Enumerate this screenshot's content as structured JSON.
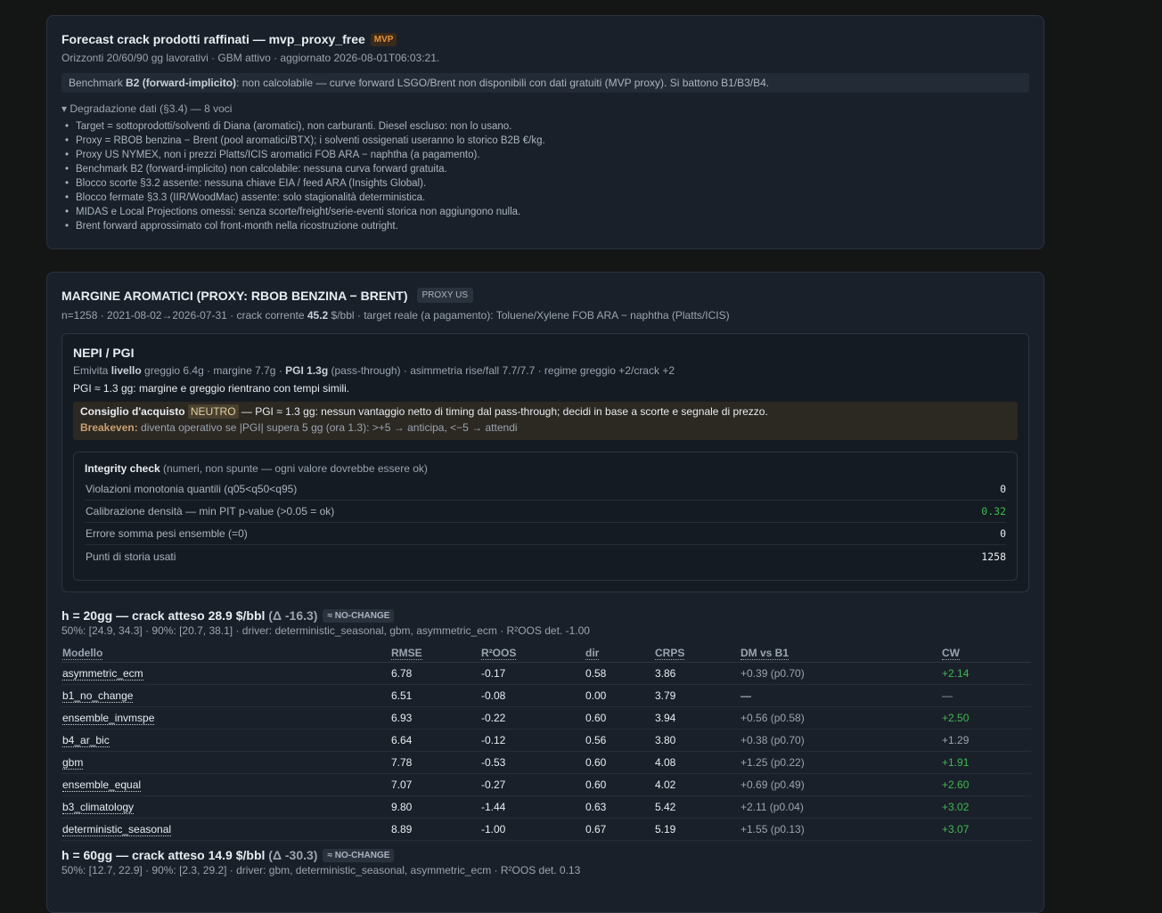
{
  "header": {
    "title": "Forecast crack prodotti raffinati — mvp_proxy_free",
    "badge": "MVP",
    "subtitle": "Orizzonti 20/60/90 gg lavorativi · GBM attivo · aggiornato 2026-08-01T06:03:21.",
    "note_prefix": "Benchmark ",
    "note_bold": "B2 (forward-implicito)",
    "note_rest": ": non calcolabile — curve forward LSGO/Brent non disponibili con dati gratuiti (MVP proxy). Si battono B1/B3/B4.",
    "degradation_summary": "▾ Degradazione dati (§3.4) — 8 voci",
    "degradation_items": [
      "Target = sottoprodotti/solventi di Diana (aromatici), non carburanti. Diesel escluso: non lo usano.",
      "Proxy = RBOB benzina − Brent (pool aromatici/BTX); i solventi ossigenati useranno lo storico B2B €/kg.",
      "Proxy US NYMEX, non i prezzi Platts/ICIS aromatici FOB ARA − naphtha (a pagamento).",
      "Benchmark B2 (forward-implicito) non calcolabile: nessuna curva forward gratuita.",
      "Blocco scorte §3.2 assente: nessuna chiave EIA / feed ARA (Insights Global).",
      "Blocco fermate §3.3 (IIR/WoodMac) assente: solo stagionalità deterministica.",
      "MIDAS e Local Projections omessi: senza scorte/freight/serie-eventi storica non aggiungono nulla.",
      "Brent forward approssimato col front-month nella ricostruzione outright."
    ]
  },
  "section": {
    "title": "MARGINE AROMATICI (PROXY: RBOB BENZINA − BRENT)",
    "badge": "PROXY US",
    "sub_pre": "n=1258 · 2021-08-02→2026-07-31 · crack corrente ",
    "sub_bold": "45.2",
    "sub_post": " $/bbl · target reale (a pagamento): Toluene/Xylene FOB ARA − naphtha (Platts/ICIS)",
    "nepi": {
      "title": "NEPI / PGI",
      "sub_a": "Emivita ",
      "sub_b": "livello",
      "sub_c": " greggio 6.4g · margine 7.7g · ",
      "sub_d": "PGI 1.3g",
      "sub_e": " (pass-through) · asimmetria rise/fall 7.7/7.7 · regime greggio +2/crack +2",
      "text": "PGI ≈ 1.3 gg: margine e greggio rientrano con tempi simili.",
      "advice_label": "Consiglio d'acquisto",
      "advice_badge": "NEUTRO",
      "advice_text": " — PGI ≈ 1.3 gg: nessun vantaggio netto di timing dal pass-through; decidi in base a scorte e segnale di prezzo.",
      "breakeven_label": "Breakeven:",
      "breakeven_text": " diventa operativo se |PGI| supera 5 gg (ora 1.3): >+5 → anticipa, <−5 → attendi"
    },
    "integrity": {
      "title": "Integrity check",
      "subtitle": " (numeri, non spunte — ogni valore dovrebbe essere ok)",
      "rows": [
        {
          "label": "Violazioni monotonia quantili (q05<q50<q95)",
          "value": "0"
        },
        {
          "label": "Calibrazione densità — min PIT p-value (>0.05 = ok)",
          "value": "0.32"
        },
        {
          "label": "Errore somma pesi ensemble (=0)",
          "value": "0"
        },
        {
          "label": "Punti di storia usati",
          "value": "1258"
        }
      ]
    },
    "h20": {
      "head_a": "h = 20gg — crack atteso ",
      "head_b": "28.9",
      "head_c": " $/bbl ",
      "delta": "(Δ -16.3)",
      "badge": "≈ NO-CHANGE",
      "sub": "50%: [24.9, 34.3] · 90%: [20.7, 38.1] · driver: deterministic_seasonal, gbm, asymmetric_ecm · R²OOS det. -1.00",
      "columns": [
        "Modello",
        "RMSE",
        "R²OOS",
        "dir",
        "CRPS",
        "DM vs B1",
        "CW"
      ],
      "rows": [
        [
          "asymmetric_ecm",
          "6.78",
          "-0.17",
          "0.58",
          "3.86",
          "+0.39 (p0.70)",
          "+2.14"
        ],
        [
          "b1_no_change",
          "6.51",
          "-0.08",
          "0.00",
          "3.79",
          "—",
          "—"
        ],
        [
          "ensemble_invmspe",
          "6.93",
          "-0.22",
          "0.60",
          "3.94",
          "+0.56 (p0.58)",
          "+2.50"
        ],
        [
          "b4_ar_bic",
          "6.64",
          "-0.12",
          "0.56",
          "3.80",
          "+0.38 (p0.70)",
          "+1.29"
        ],
        [
          "gbm",
          "7.78",
          "-0.53",
          "0.60",
          "4.08",
          "+1.25 (p0.22)",
          "+1.91"
        ],
        [
          "ensemble_equal",
          "7.07",
          "-0.27",
          "0.60",
          "4.02",
          "+0.69 (p0.49)",
          "+2.60"
        ],
        [
          "b3_climatology",
          "9.80",
          "-1.44",
          "0.63",
          "5.42",
          "+2.11 (p0.04)",
          "+3.02"
        ],
        [
          "deterministic_seasonal",
          "8.89",
          "-1.00",
          "0.67",
          "5.19",
          "+1.55 (p0.13)",
          "+3.07"
        ]
      ]
    },
    "h60": {
      "head_a": "h = 60gg — crack atteso ",
      "head_b": "14.9",
      "head_c": " $/bbl ",
      "delta": "(Δ -30.3)",
      "badge": "≈ NO-CHANGE",
      "sub": "50%: [12.7, 22.9] · 90%: [2.3, 29.2] · driver: gbm, deterministic_seasonal, asymmetric_ecm · R²OOS det. 0.13"
    }
  },
  "colors": {
    "positive": "#3fb950",
    "accent_badge": "#e8913a"
  }
}
